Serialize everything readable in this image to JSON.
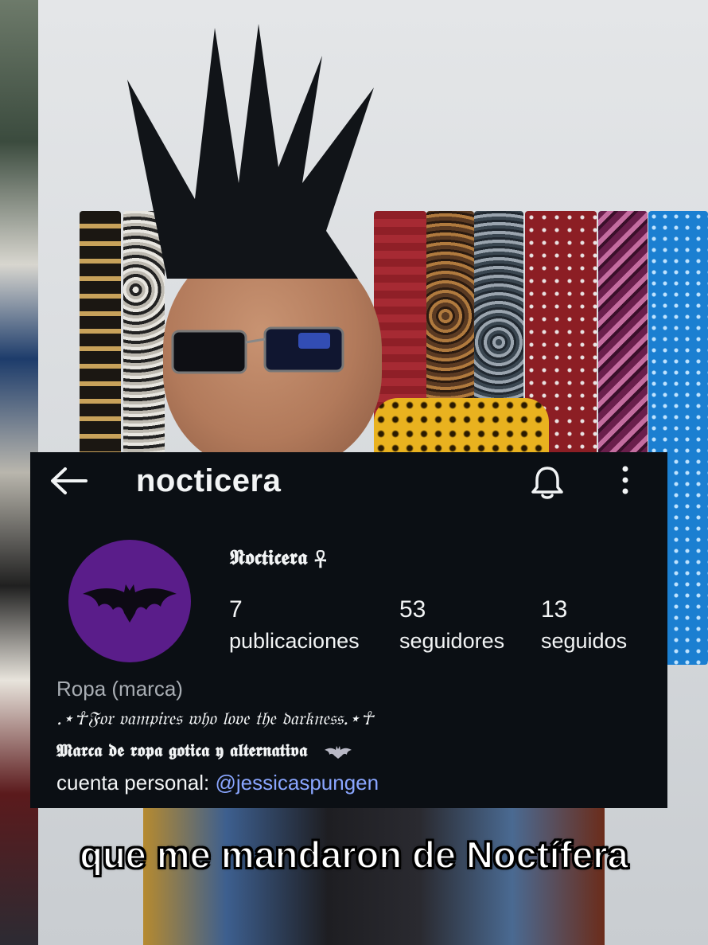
{
  "profile": {
    "username": "nocticera",
    "display_name": "𝕹𝖔𝖈𝖙𝖎𝖈𝖊𝖗𝖆 ☥",
    "avatar_icon": "bat-icon",
    "avatar_color": "#5a1d8a",
    "stats": [
      {
        "value": "7",
        "label": "publicaciones"
      },
      {
        "value": "53",
        "label": "seguidores"
      },
      {
        "value": "13",
        "label": "seguidos"
      }
    ],
    "category": "Ropa (marca)",
    "bio_line1": ".⋆☥𝔉𝔬𝔯 𝔳𝔞𝔪𝔭𝔦𝔯𝔢𝔰 𝔴𝔥𝔬 𝔩𝔬𝔳𝔢 𝔱𝔥𝔢 𝔡𝔞𝔯𝔨𝔫𝔢𝔰𝔰.⋆☥",
    "bio_line2": "𝕸𝖆𝖗𝖈𝖆 𝖉𝖊 𝖗𝖔𝖕𝖆 𝖌𝖔𝖙𝖎𝖈𝖆 𝖞 𝖆𝖑𝖙𝖊𝖗𝖓𝖆𝖙𝖎𝖛𝖆",
    "bio_line3_prefix": "cuenta personal: ",
    "bio_line3_mention": "@jessicaspungen",
    "mention_color": "#8aa6ff"
  },
  "icons": {
    "back": "back-arrow-icon",
    "bell": "bell-icon",
    "more": "more-options-icon"
  },
  "caption": "que me mandaron de Noctífera"
}
